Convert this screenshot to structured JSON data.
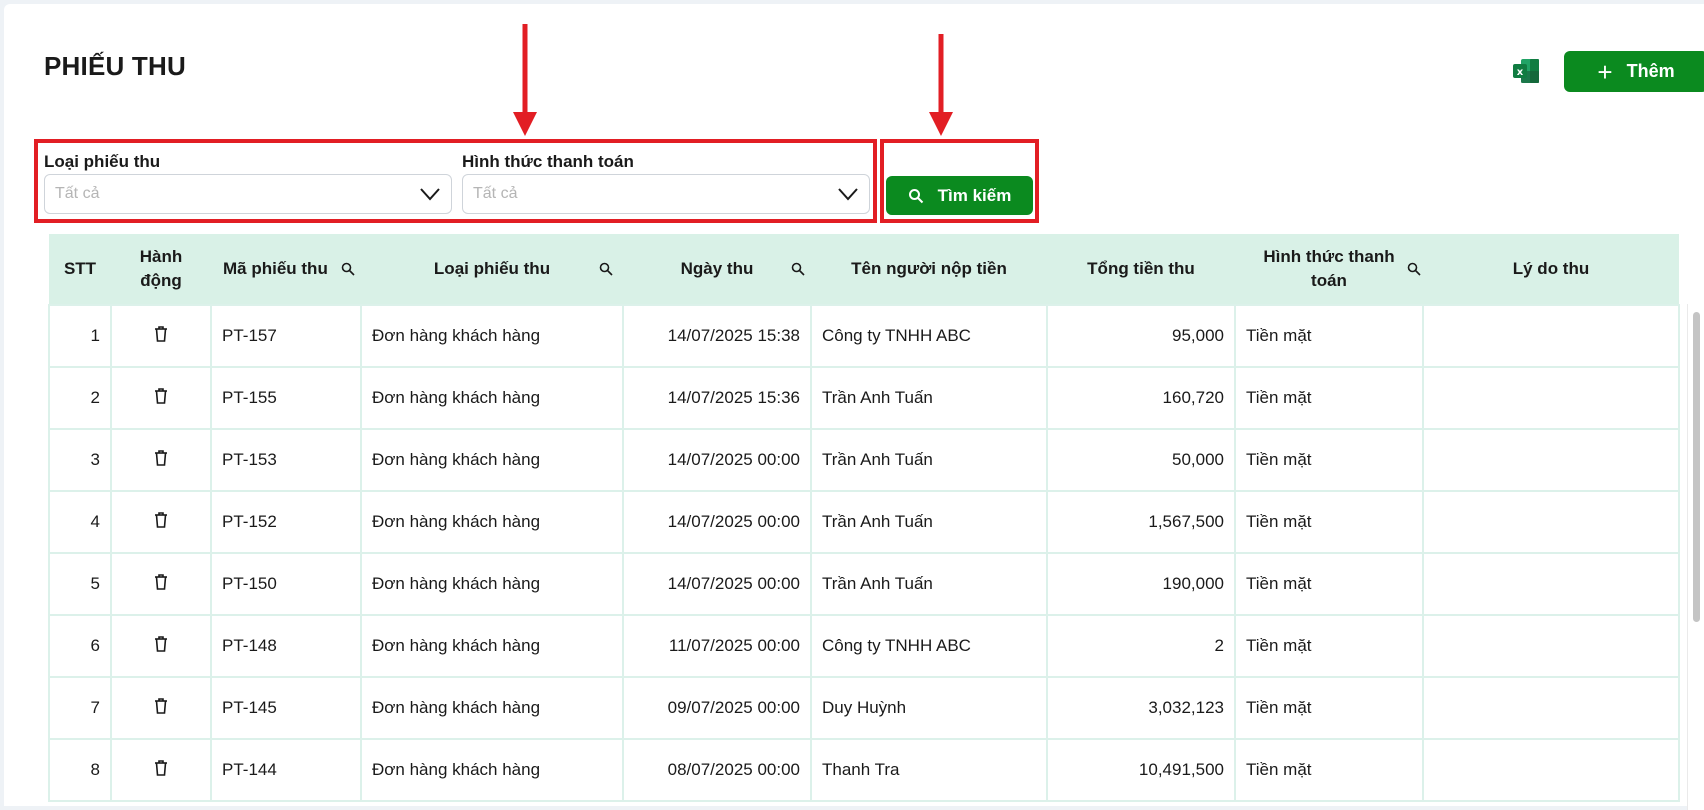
{
  "header": {
    "title": "PHIẾU THU",
    "add_label": "Thêm",
    "excel_icon": "excel-icon"
  },
  "filters": {
    "receipt_type": {
      "label": "Loại phiếu thu",
      "placeholder": "Tất cả"
    },
    "payment_method": {
      "label": "Hình thức thanh toán",
      "placeholder": "Tất cả"
    },
    "search_label": "Tìm kiếm"
  },
  "table": {
    "columns": [
      "STT",
      "Hành động",
      "Mã phiếu thu",
      "Loại phiếu thu",
      "Ngày thu",
      "Tên người nộp tiền",
      "Tổng tiền thu",
      "Hình thức thanh toán",
      "Lý do thu"
    ],
    "rows": [
      {
        "stt": "1",
        "code": "PT-157",
        "type": "Đơn hàng khách hàng",
        "date": "14/07/2025 15:38",
        "payer": "Công ty TNHH ABC",
        "amount": "95,000",
        "method": "Tiền mặt",
        "reason": ""
      },
      {
        "stt": "2",
        "code": "PT-155",
        "type": "Đơn hàng khách hàng",
        "date": "14/07/2025 15:36",
        "payer": "Trần Anh Tuấn",
        "amount": "160,720",
        "method": "Tiền mặt",
        "reason": ""
      },
      {
        "stt": "3",
        "code": "PT-153",
        "type": "Đơn hàng khách hàng",
        "date": "14/07/2025 00:00",
        "payer": "Trần Anh Tuấn",
        "amount": "50,000",
        "method": "Tiền mặt",
        "reason": ""
      },
      {
        "stt": "4",
        "code": "PT-152",
        "type": "Đơn hàng khách hàng",
        "date": "14/07/2025 00:00",
        "payer": "Trần Anh Tuấn",
        "amount": "1,567,500",
        "method": "Tiền mặt",
        "reason": ""
      },
      {
        "stt": "5",
        "code": "PT-150",
        "type": "Đơn hàng khách hàng",
        "date": "14/07/2025 00:00",
        "payer": "Trần Anh Tuấn",
        "amount": "190,000",
        "method": "Tiền mặt",
        "reason": ""
      },
      {
        "stt": "6",
        "code": "PT-148",
        "type": "Đơn hàng khách hàng",
        "date": "11/07/2025 00:00",
        "payer": "Công ty TNHH ABC",
        "amount": "2",
        "method": "Tiền mặt",
        "reason": ""
      },
      {
        "stt": "7",
        "code": "PT-145",
        "type": "Đơn hàng khách hàng",
        "date": "09/07/2025 00:00",
        "payer": "Duy Huỳnh",
        "amount": "3,032,123",
        "method": "Tiền mặt",
        "reason": ""
      },
      {
        "stt": "8",
        "code": "PT-144",
        "type": "Đơn hàng khách hàng",
        "date": "08/07/2025 00:00",
        "payer": "Thanh Tra",
        "amount": "10,491,500",
        "method": "Tiền mặt",
        "reason": ""
      }
    ]
  },
  "colors": {
    "accent": "#0b8a1f",
    "header_bg": "#d9f1e7",
    "annotation_red": "#e21e24"
  }
}
